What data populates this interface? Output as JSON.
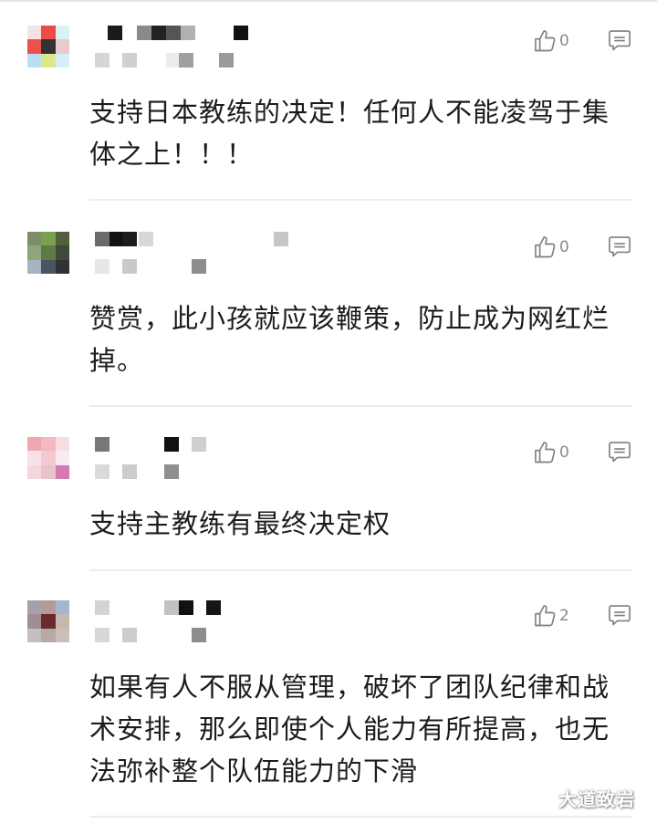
{
  "comments": [
    {
      "likes": "0",
      "text": "支持日本教练的决定！任何人不能凌驾于集\n体之上！！！",
      "avatar": [
        "#f5e3e3",
        "#ee4a4a",
        "#dcf0f7",
        "#ee5050",
        "#333333",
        "#e8cccc",
        "#b9dff2",
        "#dde88a",
        "#d7eef8"
      ]
    },
    {
      "likes": "0",
      "text": "赞赏，此小孩就应该鞭策，防止成为网红烂\n掉。",
      "avatar": [
        "#7d8d67",
        "#7aa04d",
        "#526040",
        "#8fa67a",
        "#607a45",
        "#3d4a3a",
        "#a7b3c0",
        "#4a5564",
        "#2f3338"
      ]
    },
    {
      "likes": "0",
      "text": "支持主教练有最终决定权",
      "avatar": [
        "#f0a8b0",
        "#f2b9c1",
        "#f6dde0",
        "#f7e3e7",
        "#f5c9d0",
        "#f8eaee",
        "#f4d6dc",
        "#e8c3ca",
        "#d57ab0"
      ]
    },
    {
      "likes": "2",
      "text": "如果有人不服从管理，破坏了团队纪律和战\n术安排，那么即使个人能力有所提高，也无\n法弥补整个队伍能力的下滑",
      "avatar": [
        "#a6a0a8",
        "#b69a9a",
        "#a2b6cf",
        "#a18e94",
        "#6a2a2e",
        "#c7b7ac",
        "#c2bfc3",
        "#b8a8a8",
        "#cdbfb6"
      ]
    }
  ],
  "watermark": "大道致岩",
  "icons": {
    "like": "thumbs-up-icon",
    "reply": "comment-icon"
  },
  "colors": {
    "text": "#1c1c1c",
    "count": "#8a8a8a",
    "divider": "#ececec"
  }
}
